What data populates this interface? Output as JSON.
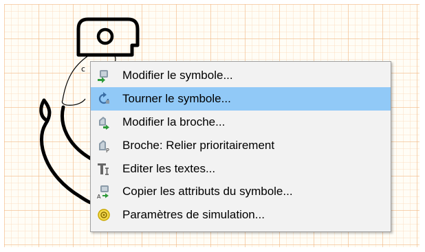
{
  "menu": {
    "items": [
      {
        "label": "Modifier le symbole...",
        "icon": "symbol-edit-icon"
      },
      {
        "label": "Tourner le symbole...",
        "icon": "rotate-icon",
        "selected": true
      },
      {
        "label": "Modifier la broche...",
        "icon": "pin-edit-icon"
      },
      {
        "label": "Broche: Relier prioritairement",
        "icon": "pin-priority-icon"
      },
      {
        "label": "Editer les textes...",
        "icon": "text-edit-icon"
      },
      {
        "label": "Copier les attributs du symbole...",
        "icon": "copy-attributes-icon"
      },
      {
        "label": "Paramètres de simulation...",
        "icon": "simulation-icon"
      }
    ],
    "highlight_color": "#91c9f7"
  },
  "canvas": {
    "grid_color": "#f0b078",
    "background": "#fffdf6"
  }
}
